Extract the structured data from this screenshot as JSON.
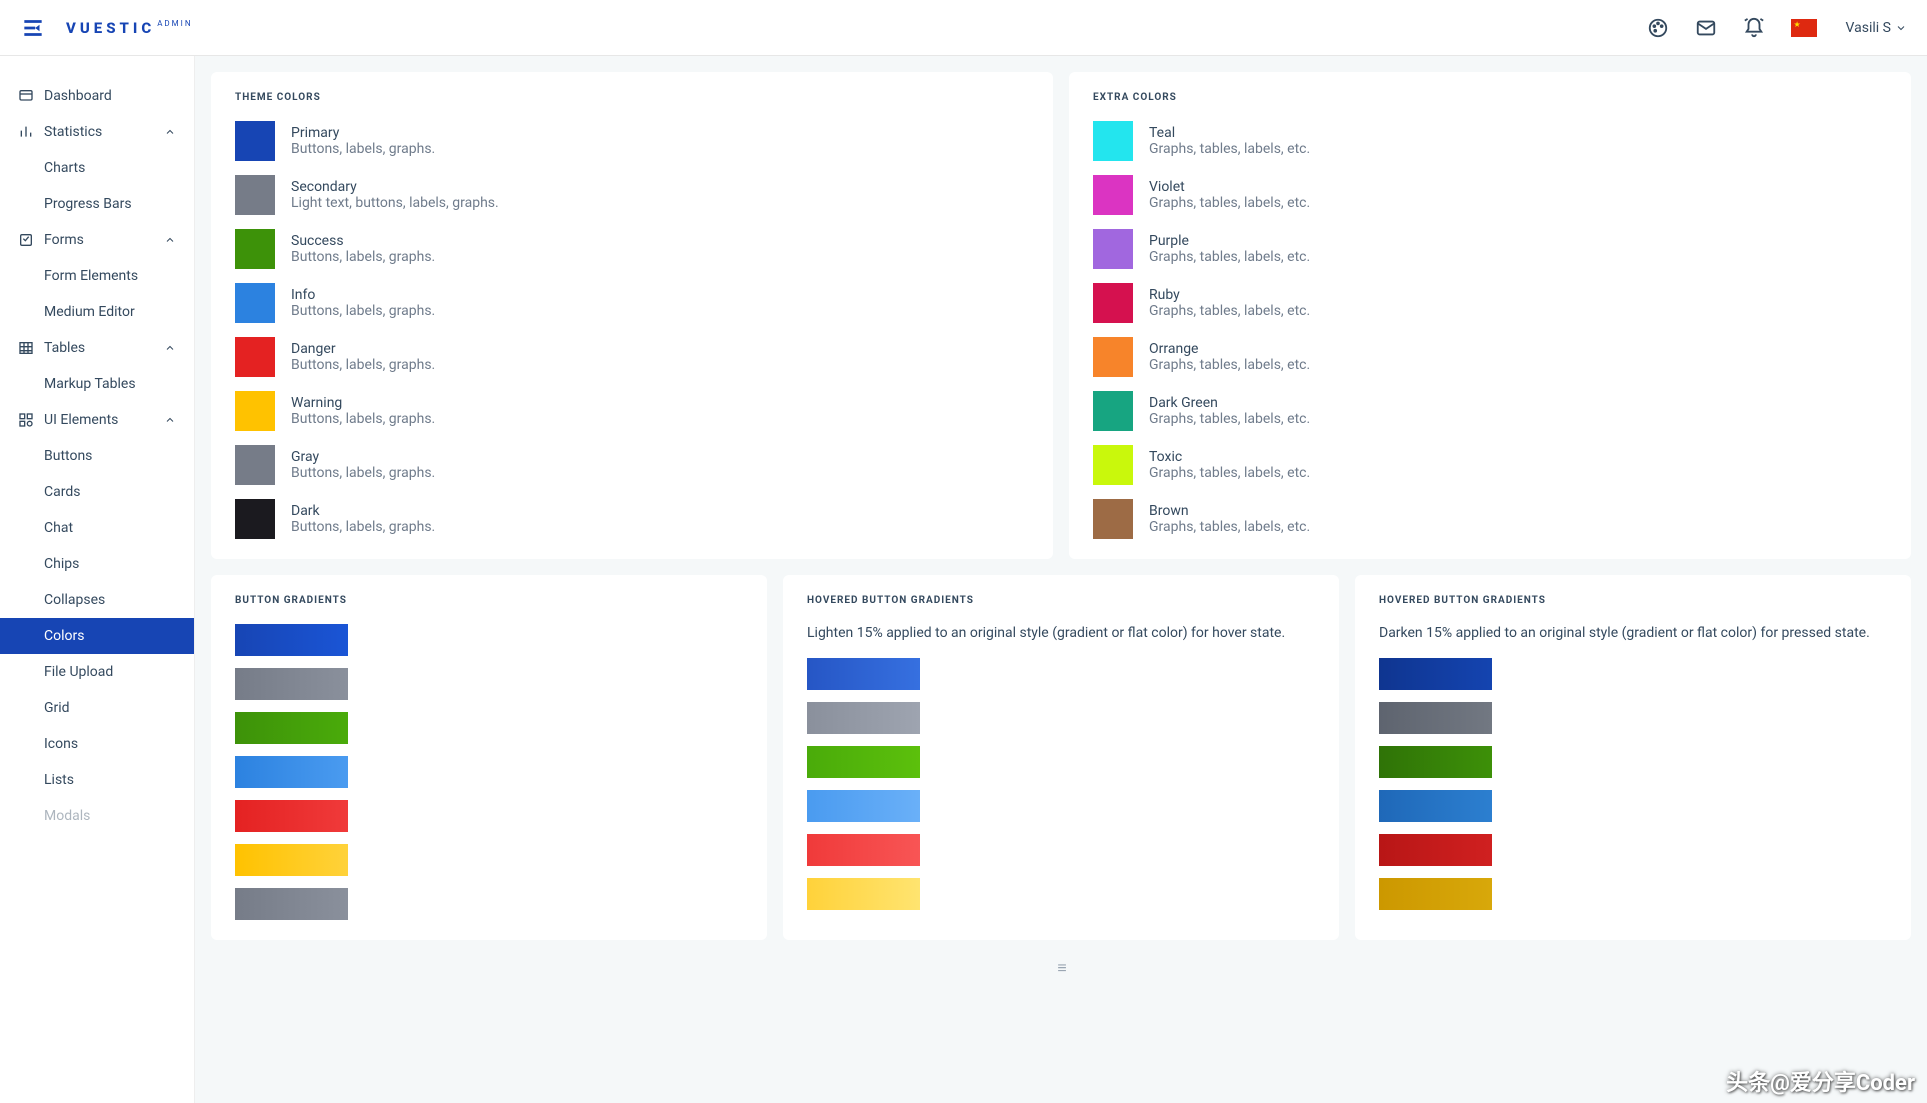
{
  "header": {
    "logo_main": "VUESTIC",
    "logo_sub": "ADMIN",
    "user_name": "Vasili S"
  },
  "sidebar": {
    "dashboard": "Dashboard",
    "statistics": {
      "label": "Statistics",
      "charts": "Charts",
      "progress": "Progress Bars"
    },
    "forms": {
      "label": "Forms",
      "elements": "Form Elements",
      "medium": "Medium Editor"
    },
    "tables": {
      "label": "Tables",
      "markup": "Markup Tables"
    },
    "ui": {
      "label": "UI Elements",
      "buttons": "Buttons",
      "cards": "Cards",
      "chat": "Chat",
      "chips": "Chips",
      "collapses": "Collapses",
      "colors": "Colors",
      "file_upload": "File Upload",
      "grid": "Grid",
      "icons": "Icons",
      "lists": "Lists",
      "modals": "Modals"
    }
  },
  "theme_colors": {
    "title": "THEME COLORS",
    "items": [
      {
        "name": "Primary",
        "usage": "Buttons, labels, graphs.",
        "hex": "#1745b4"
      },
      {
        "name": "Secondary",
        "usage": "Light text, buttons, labels, graphs.",
        "hex": "#767c88"
      },
      {
        "name": "Success",
        "usage": "Buttons, labels, graphs.",
        "hex": "#3d9209"
      },
      {
        "name": "Info",
        "usage": "Buttons, labels, graphs.",
        "hex": "#2c82e0"
      },
      {
        "name": "Danger",
        "usage": "Buttons, labels, graphs.",
        "hex": "#e42222"
      },
      {
        "name": "Warning",
        "usage": "Buttons, labels, graphs.",
        "hex": "#ffc200"
      },
      {
        "name": "Gray",
        "usage": "Buttons, labels, graphs.",
        "hex": "#767c88"
      },
      {
        "name": "Dark",
        "usage": "Buttons, labels, graphs.",
        "hex": "#1b1a1f"
      }
    ]
  },
  "extra_colors": {
    "title": "EXTRA COLORS",
    "items": [
      {
        "name": "Teal",
        "usage": "Graphs, tables, labels, etc.",
        "hex": "#23e5ee"
      },
      {
        "name": "Violet",
        "usage": "Graphs, tables, labels, etc.",
        "hex": "#db34c2"
      },
      {
        "name": "Purple",
        "usage": "Graphs, tables, labels, etc.",
        "hex": "#a167df"
      },
      {
        "name": "Ruby",
        "usage": "Graphs, tables, labels, etc.",
        "hex": "#d5114f"
      },
      {
        "name": "Orrange",
        "usage": "Graphs, tables, labels, etc.",
        "hex": "#f7842a"
      },
      {
        "name": "Dark Green",
        "usage": "Graphs, tables, labels, etc.",
        "hex": "#17a581"
      },
      {
        "name": "Toxic",
        "usage": "Graphs, tables, labels, etc.",
        "hex": "#c9f80c"
      },
      {
        "name": "Brown",
        "usage": "Graphs, tables, labels, etc.",
        "hex": "#9d6b45"
      }
    ]
  },
  "button_gradients": {
    "title": "BUTTON GRADIENTS",
    "colors": [
      {
        "from": "#1745b4",
        "to": "#1a55d6"
      },
      {
        "from": "#767c88",
        "to": "#8a909c"
      },
      {
        "from": "#3d9209",
        "to": "#4aab0a"
      },
      {
        "from": "#2c82e0",
        "to": "#4a9bf0"
      },
      {
        "from": "#e42222",
        "to": "#f03a3a"
      },
      {
        "from": "#ffc200",
        "to": "#ffd23a"
      },
      {
        "from": "#767c88",
        "to": "#8a909c"
      }
    ]
  },
  "hovered_gradients": {
    "title": "HOVERED BUTTON GRADIENTS",
    "desc": "Lighten 15% applied to an original style (gradient or flat color) for hover state.",
    "colors": [
      {
        "from": "#2656c5",
        "to": "#3670e0"
      },
      {
        "from": "#8a909c",
        "to": "#9ea4b0"
      },
      {
        "from": "#4aab0a",
        "to": "#5cc00c"
      },
      {
        "from": "#4a9bf0",
        "to": "#6ab0f8"
      },
      {
        "from": "#f03a3a",
        "to": "#f85555"
      },
      {
        "from": "#ffd23a",
        "to": "#ffe470"
      }
    ]
  },
  "pressed_gradients": {
    "title": "HOVERED BUTTON GRADIENTS",
    "desc": "Darken 15% applied to an original style (gradient or flat color) for pressed state.",
    "colors": [
      {
        "from": "#0f3590",
        "to": "#1444b0"
      },
      {
        "from": "#5e646f",
        "to": "#727882"
      },
      {
        "from": "#2f7307",
        "to": "#3d9008"
      },
      {
        "from": "#1f68b8",
        "to": "#2c7fd0"
      },
      {
        "from": "#b81616",
        "to": "#d02020"
      },
      {
        "from": "#cc9800",
        "to": "#d8a80a"
      }
    ]
  },
  "watermark": "头条@爱分享Coder"
}
